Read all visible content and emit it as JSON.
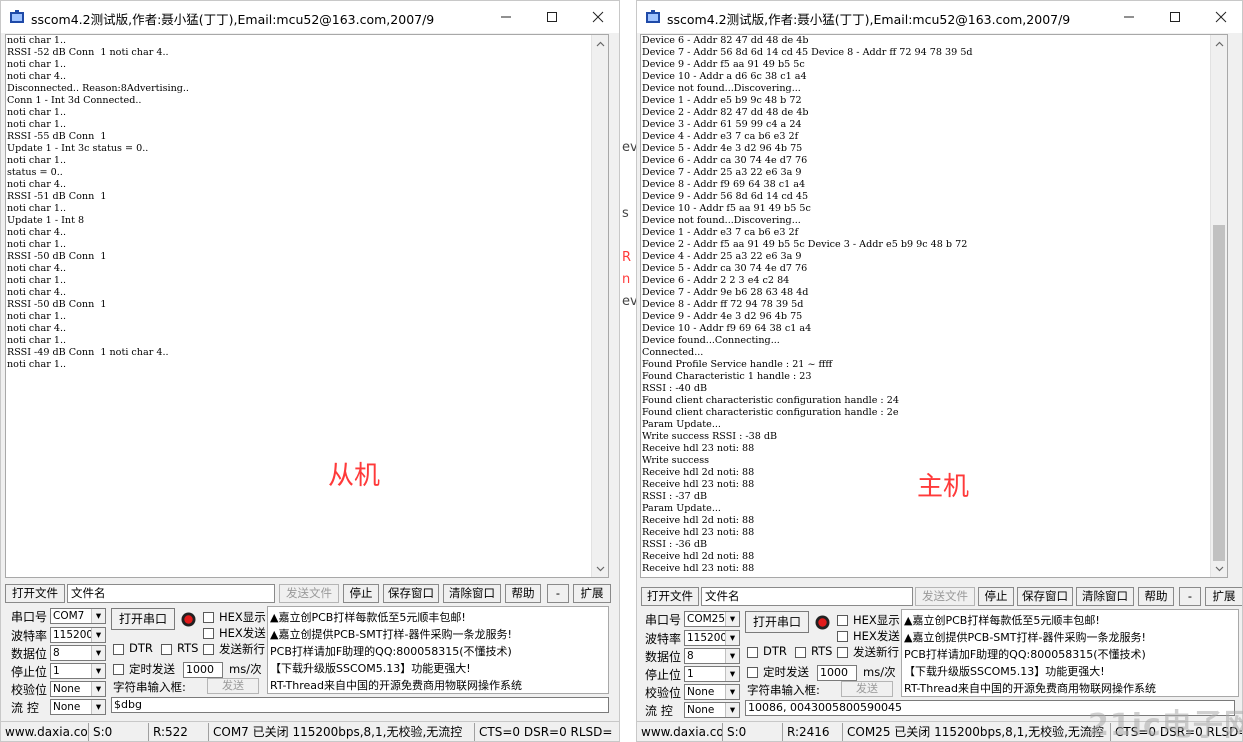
{
  "left": {
    "title": "sscom4.2测试版,作者:聂小猛(丁丁),Email:mcu52@163.com,2007/9",
    "lines": [
      "noti char 1..",
      "RSSI -52 dB Conn  1 noti char 4..",
      "noti char 1..",
      "noti char 4..",
      "Disconnected.. Reason:8Advertising..",
      "Conn 1 - Int 3d Connected..",
      "noti char 1..",
      "noti char 1..",
      "RSSI -55 dB Conn  1",
      "Update 1 - Int 3c status = 0..",
      "noti char 1..",
      "status = 0..",
      "noti char 4..",
      "RSSI -51 dB Conn  1",
      "noti char 1..",
      "Update 1 - Int 8",
      "noti char 4..",
      "noti char 1..",
      "RSSI -50 dB Conn  1",
      "noti char 4..",
      "noti char 1..",
      "noti char 4..",
      "RSSI -50 dB Conn  1",
      "noti char 1..",
      "noti char 4..",
      "noti char 1..",
      "RSSI -49 dB Conn  1 noti char 4..",
      "noti char 1.."
    ],
    "watermark": "从机",
    "file_value": "文件名",
    "port": "COM7",
    "baud": "115200",
    "databits": "8",
    "stopbits": "1",
    "parity": "None",
    "flow": "None",
    "interval": "1000",
    "send_text": "$dbg",
    "status": {
      "site": "www.daxia.com",
      "s": "S:0",
      "r": "R:522",
      "port_state": "COM7 已关闭  115200bps,8,1,无校验,无流控",
      "lines": "CTS=0 DSR=0 RLSD="
    }
  },
  "right": {
    "title": "sscom4.2测试版,作者:聂小猛(丁丁),Email:mcu52@163.com,2007/9",
    "lines": [
      "Device 6 - Addr 82 47 dd 48 de 4b",
      "Device 7 - Addr 56 8d 6d 14 cd 45 Device 8 - Addr ff 72 94 78 39 5d",
      "Device 9 - Addr f5 aa 91 49 b5 5c",
      "Device 10 - Addr a d6 6c 38 c1 a4",
      "Device not found...Discovering...",
      "Device 1 - Addr e5 b9 9c 48 b 72",
      "Device 2 - Addr 82 47 dd 48 de 4b",
      "Device 3 - Addr 61 59 99 c4 a 24",
      "Device 4 - Addr e3 7 ca b6 e3 2f",
      "Device 5 - Addr 4e 3 d2 96 4b 75",
      "Device 6 - Addr ca 30 74 4e d7 76",
      "Device 7 - Addr 25 a3 22 e6 3a 9",
      "Device 8 - Addr f9 69 64 38 c1 a4",
      "Device 9 - Addr 56 8d 6d 14 cd 45",
      "Device 10 - Addr f5 aa 91 49 b5 5c",
      "Device not found...Discovering...",
      "Device 1 - Addr e3 7 ca b6 e3 2f",
      "Device 2 - Addr f5 aa 91 49 b5 5c Device 3 - Addr e5 b9 9c 48 b 72",
      "Device 4 - Addr 25 a3 22 e6 3a 9",
      "Device 5 - Addr ca 30 74 4e d7 76",
      "Device 6 - Addr 2 2 3 e4 c2 84",
      "Device 7 - Addr 9e b6 28 63 48 4d",
      "Device 8 - Addr ff 72 94 78 39 5d",
      "Device 9 - Addr 4e 3 d2 96 4b 75",
      "Device 10 - Addr f9 69 64 38 c1 a4",
      "Device found...Connecting...",
      "Connected...",
      "Found Profile Service handle : 21 ~ ffff",
      "Found Characteristic 1 handle : 23",
      "RSSI : -40 dB",
      "Found client characteristic configuration handle : 24",
      "Found client characteristic configuration handle : 2e",
      "Param Update...",
      "Write success RSSI : -38 dB",
      "Receive hdl 23 noti: 88",
      "Write success",
      "Receive hdl 2d noti: 88",
      "Receive hdl 23 noti: 88",
      "RSSI : -37 dB",
      "Param Update...",
      "Receive hdl 2d noti: 88",
      "Receive hdl 23 noti: 88",
      "RSSI : -36 dB",
      "Receive hdl 2d noti: 88",
      "Receive hdl 23 noti: 88"
    ],
    "watermark": "主机",
    "file_value": "文件名",
    "port": "COM25",
    "baud": "115200",
    "databits": "8",
    "stopbits": "1",
    "parity": "None",
    "flow": "None",
    "interval": "1000",
    "send_text": "10086, 0043005800590045",
    "status": {
      "site": "www.daxia.com",
      "s": "S:0",
      "r": "R:2416",
      "port_state": "COM25 已关闭  115200bps,8,1,无校验,无流控",
      "lines": "CTS=0 DSR=0 RLSD="
    }
  },
  "labels": {
    "open_file": "打开文件",
    "send_file": "发送文件",
    "stop": "停止",
    "save_window": "保存窗口",
    "clear_window": "清除窗口",
    "help": "帮助",
    "minus": "-",
    "expand": "扩展",
    "port": "串口号",
    "baud": "波特率",
    "databits": "数据位",
    "stopbits": "停止位",
    "parity": "校验位",
    "flow": "流 控",
    "open_port": "打开串口",
    "hex_display": "HEX显示",
    "hex_send": "HEX发送",
    "send_newline": "发送新行",
    "dtr": "DTR",
    "rts": "RTS",
    "timed_send": "定时发送",
    "ms_per": "ms/次",
    "string_input": "字符串输入框:",
    "send": "发送"
  },
  "ads": [
    "▲嘉立创PCB打样每款低至5元顺丰包邮!",
    "▲嘉立创提供PCB-SMT打样-器件采购一条龙服务!",
    "PCB打样请加F助理的QQ:800058315(不懂技术)",
    "【下载升级版SSCOM5.13】功能更强大!",
    "RT-Thread来自中国的开源免费商用物联网操作系统"
  ],
  "gap_fragments": [
    "ev",
    "s",
    "R",
    "n",
    "ev"
  ],
  "logo": "21ic电子网",
  "colors": {
    "watermark": "#ff3a3a",
    "titlebar": "#ffffff",
    "window_bg": "#f0f0f0"
  }
}
